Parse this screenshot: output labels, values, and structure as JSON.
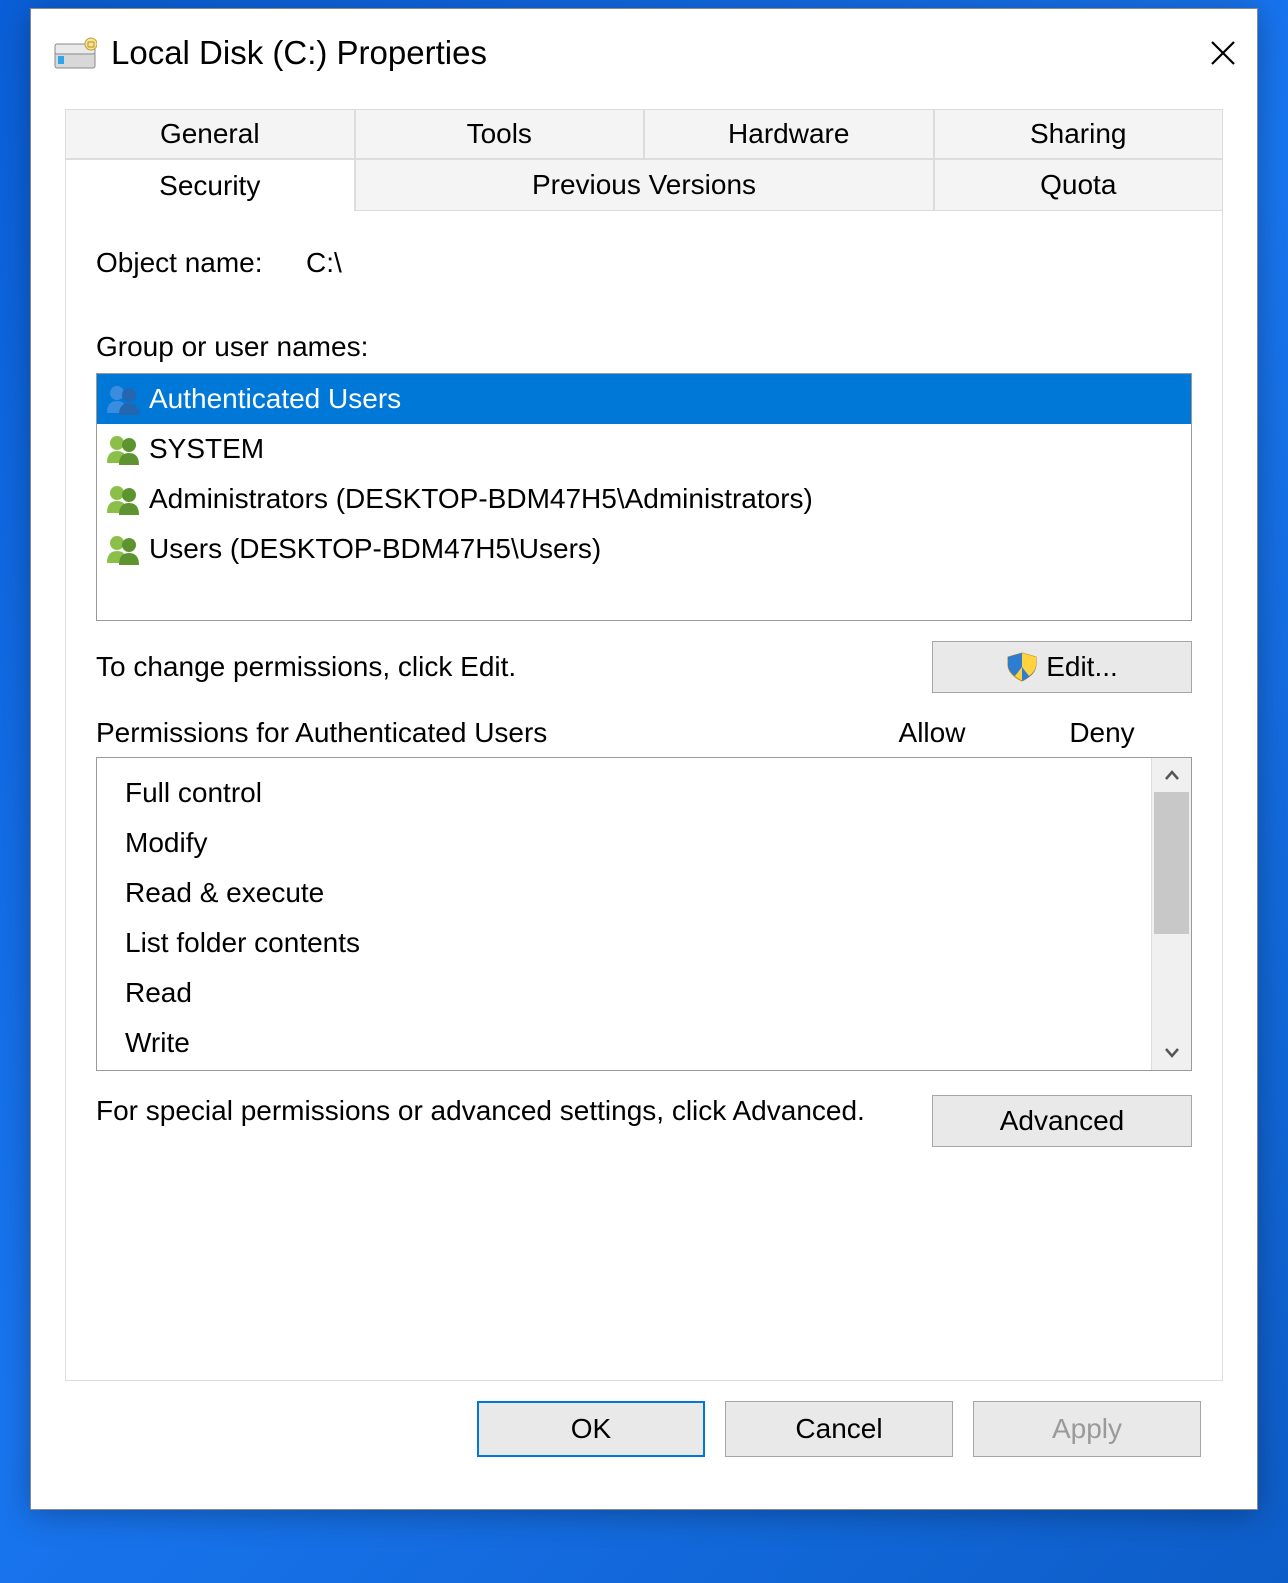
{
  "title": "Local Disk (C:) Properties",
  "tabs": {
    "row1": [
      "General",
      "Tools",
      "Hardware",
      "Sharing"
    ],
    "row2": {
      "security": "Security",
      "previous": "Previous Versions",
      "quota": "Quota"
    },
    "active": "Security"
  },
  "object_name_label": "Object name:",
  "object_name_value": "C:\\",
  "groups_label": "Group or user names:",
  "groups": [
    {
      "name": "Authenticated Users",
      "selected": true,
      "color": "blue"
    },
    {
      "name": "SYSTEM",
      "selected": false,
      "color": "green"
    },
    {
      "name": "Administrators (DESKTOP-BDM47H5\\Administrators)",
      "selected": false,
      "color": "green"
    },
    {
      "name": "Users (DESKTOP-BDM47H5\\Users)",
      "selected": false,
      "color": "green"
    }
  ],
  "edit_hint": "To change permissions, click Edit.",
  "edit_button": "Edit...",
  "perm_header": "Permissions for Authenticated Users",
  "col_allow": "Allow",
  "col_deny": "Deny",
  "permissions": [
    "Full control",
    "Modify",
    "Read & execute",
    "List folder contents",
    "Read",
    "Write"
  ],
  "advanced_hint": "For special permissions or advanced settings, click Advanced.",
  "advanced_button": "Advanced",
  "footer": {
    "ok": "OK",
    "cancel": "Cancel",
    "apply": "Apply"
  }
}
